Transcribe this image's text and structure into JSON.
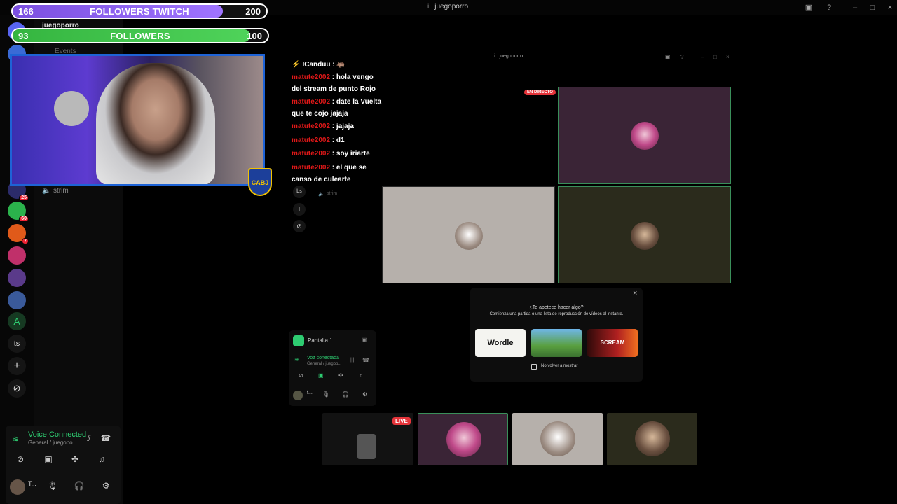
{
  "titlebar": {
    "title": "juegoporro",
    "info_icon": "info-icon"
  },
  "followers_twitch": {
    "current": "166",
    "label": "FOLLOWERS TWITCH",
    "goal": "200",
    "progress": 0.83,
    "color": "#8a5cf6"
  },
  "followers": {
    "current": "93",
    "label": "FOLLOWERS",
    "goal": "100",
    "progress": 0.93,
    "color": "#3cc84b"
  },
  "server_rail": {
    "badges": [
      "25",
      "60",
      "7"
    ],
    "text_servers": [
      "ts"
    ]
  },
  "channels": {
    "server_name": "juegoporro",
    "events_label": "Events",
    "voice_channel": "strim"
  },
  "crest_text": "CABJ",
  "chat": {
    "lines": [
      {
        "user": "ICanduu",
        "msg": " : 🦛"
      },
      {
        "user": "matute2002",
        "msg": " : hola vengo del stream de punto Rojo"
      },
      {
        "user": "matute2002",
        "msg": " : date la Vuelta que te cojo jajaja"
      },
      {
        "user": "matute2002",
        "msg": " : jajaja"
      },
      {
        "user": "matute2002",
        "msg": " : d1"
      },
      {
        "user": "matute2002",
        "msg": " : soy iriarte"
      },
      {
        "user": "matute2002",
        "msg": " : el que se canso de culearte"
      }
    ]
  },
  "inner_discord": {
    "title": "juegoporro",
    "live_label": "EN DIRECTO",
    "voice_channel": "strim",
    "server_text": "bs"
  },
  "activity_popup": {
    "question": "¿Te apetece hacer algo?",
    "description": "Comienza una partida o una lista de reproducción de vídeos al instante.",
    "cards": [
      "Wordle",
      "",
      "SCREAM"
    ],
    "dont_show": "No volver a mostrar"
  },
  "share_panel": {
    "screen": "Pantalla 1",
    "status": "Voz conectada",
    "location": "General / juegop...",
    "user": "f..."
  },
  "left_voice": {
    "status": "Voice Connected",
    "location": "General / juegopo...",
    "user": "T..."
  },
  "bottom_strip": {
    "live_label": "LIVE"
  },
  "colors": {
    "accent_green": "#2ecc71",
    "live_red": "#e5343a",
    "tile_border": "#3a8f5a"
  }
}
